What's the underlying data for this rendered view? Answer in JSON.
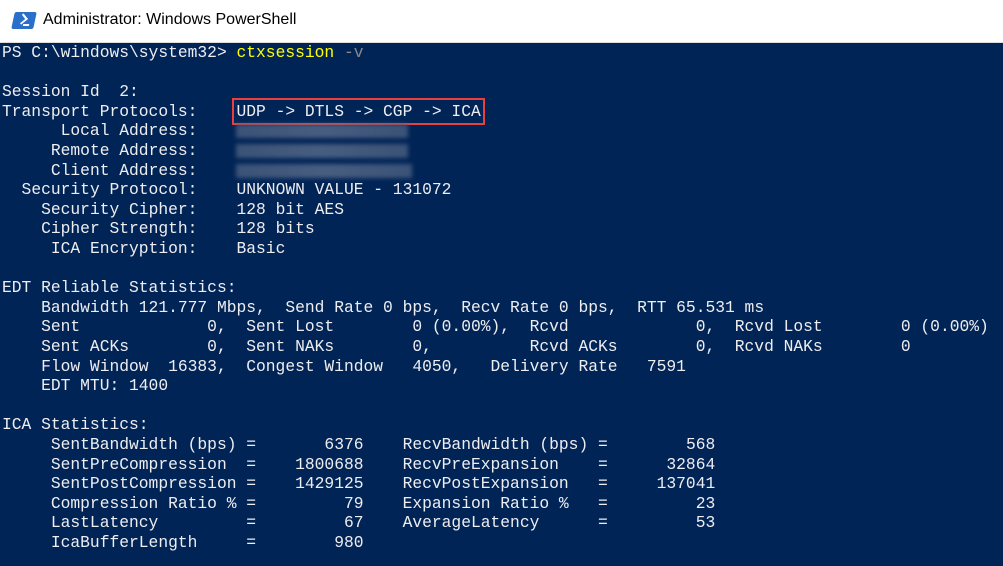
{
  "window": {
    "title": "Administrator: Windows PowerShell",
    "icon": "powershell-icon"
  },
  "prompt": {
    "text": "PS C:\\windows\\system32>",
    "command": "ctxsession",
    "argument": "-v"
  },
  "session": {
    "header": "Session Id  2:",
    "fields": [
      {
        "label": "Transport Protocols:",
        "value": "UDP -> DTLS -> CGP -> ICA"
      },
      {
        "label": "Local Address:",
        "value": ""
      },
      {
        "label": "Remote Address:",
        "value": ""
      },
      {
        "label": "Client Address:",
        "value": ""
      },
      {
        "label": "Security Protocol:",
        "value": "UNKNOWN VALUE - 131072"
      },
      {
        "label": "Security Cipher:",
        "value": "128 bit AES"
      },
      {
        "label": "Cipher Strength:",
        "value": "128 bits"
      },
      {
        "label": "ICA Encryption:",
        "value": "Basic"
      }
    ]
  },
  "edt": {
    "header": "EDT Reliable Statistics:",
    "bandwidth_line": "Bandwidth 121.777 Mbps,  Send Rate 0 bps,  Recv Rate 0 bps,  RTT 65.531 ms",
    "rows": [
      [
        "Sent",
        "0,",
        "Sent Lost",
        "0 (0.00%),",
        "Rcvd",
        "0,",
        "Rcvd Lost",
        "0 (0.00%)"
      ],
      [
        "Sent ACKs",
        "0,",
        "Sent NAKs",
        "0,",
        "Rcvd ACKs",
        "0,",
        "Rcvd NAKs",
        "0"
      ]
    ],
    "flow": [
      "Flow Window",
      "16383,",
      "Congest Window",
      "4050,",
      "Delivery Rate",
      "7591"
    ],
    "mtu": "EDT MTU: 1400"
  },
  "ica": {
    "header": "ICA Statistics:",
    "rows": [
      [
        "SentBandwidth (bps)",
        "=",
        "6376",
        "RecvBandwidth (bps)",
        "=",
        "568"
      ],
      [
        "SentPreCompression",
        "=",
        "1800688",
        "RecvPreExpansion",
        "=",
        "32864"
      ],
      [
        "SentPostCompression",
        "=",
        "1429125",
        "RecvPostExpansion",
        "=",
        "137041"
      ],
      [
        "Compression Ratio %",
        "=",
        "79",
        "Expansion Ratio %",
        "=",
        "23"
      ],
      [
        "LastLatency",
        "=",
        "67",
        "AverageLatency",
        "=",
        "53"
      ],
      [
        "IcaBufferLength",
        "=",
        "980",
        "",
        "",
        " "
      ]
    ]
  },
  "colors": {
    "background": "#012456",
    "text": "#eeedf0",
    "command": "#ffff00",
    "highlight": "#e8403f"
  }
}
